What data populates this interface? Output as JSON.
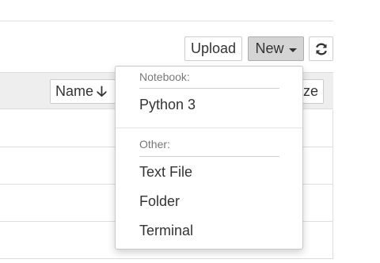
{
  "toolbar": {
    "upload_label": "Upload",
    "new_label": "New",
    "refresh_icon": "refresh-icon"
  },
  "list_header": {
    "sort_name_label": "Name",
    "sort_name_arrow_icon": "arrow-down-icon",
    "sort_size_label": "ze"
  },
  "new_menu": {
    "notebook_header": "Notebook:",
    "notebook_items": [
      "Python 3"
    ],
    "other_header": "Other:",
    "other_items": [
      "Text File",
      "Folder",
      "Terminal"
    ]
  }
}
